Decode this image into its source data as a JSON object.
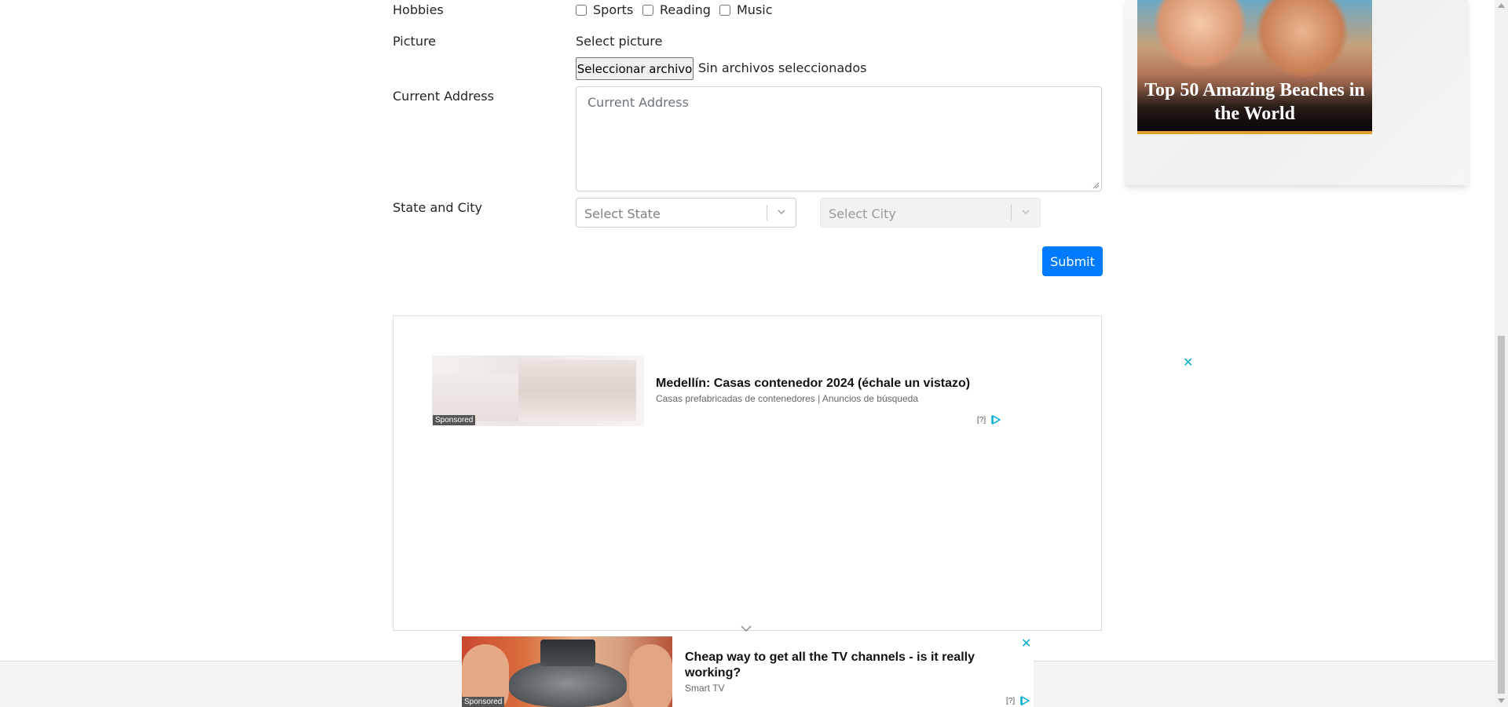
{
  "form": {
    "hobbies_label": "Hobbies",
    "hobbies": [
      {
        "label": "Sports",
        "checked": false
      },
      {
        "label": "Reading",
        "checked": false
      },
      {
        "label": "Music",
        "checked": false
      }
    ],
    "picture_label": "Picture",
    "picture_hint": "Select picture",
    "file_button": "Seleccionar archivo",
    "file_status": "Sin archivos seleccionados",
    "address_label": "Current Address",
    "address_placeholder": "Current Address",
    "state_city_label": "State and City",
    "state_placeholder": "Select State",
    "city_placeholder": "Select City",
    "submit_label": "Submit"
  },
  "ad_main": {
    "sponsored": "Sponsored",
    "title": "Medellín: Casas contenedor 2024 (échale un vistazo)",
    "subtitle": "Casas prefabricadas de contenedores | Anuncios de búsqueda",
    "help": "[?]",
    "close": "✕"
  },
  "side_banner": {
    "title": "Top 50 Amazing Beaches in the World"
  },
  "ad_bottom": {
    "sponsored": "Sponsored",
    "title": "Cheap way to get all the TV channels - is it really working?",
    "source": "Smart TV",
    "help": "[?]",
    "close": "✕"
  },
  "colors": {
    "primary": "#007bff",
    "ad_close": "#00aecd"
  }
}
